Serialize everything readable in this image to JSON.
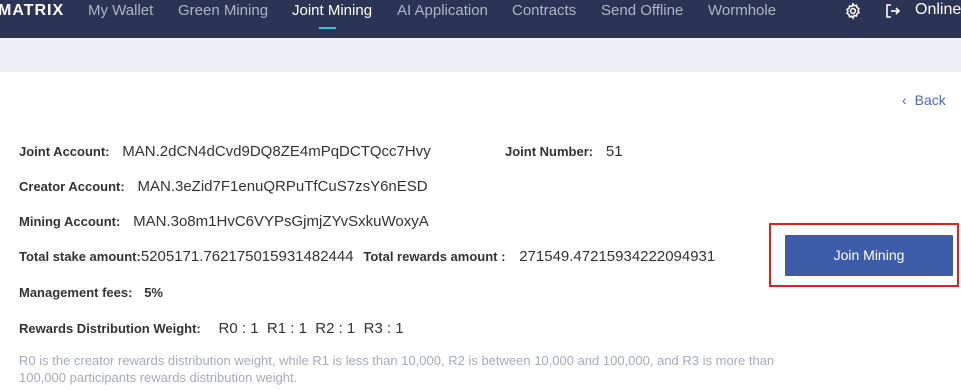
{
  "nav": {
    "brand": "MATRIX",
    "items": [
      {
        "label": "My Wallet"
      },
      {
        "label": "Green Mining"
      },
      {
        "label": "Joint Mining"
      },
      {
        "label": "AI Application"
      },
      {
        "label": "Contracts"
      },
      {
        "label": "Send Offline"
      },
      {
        "label": "Wormhole"
      }
    ],
    "active_item": "Joint Mining",
    "status": "Online",
    "settings_icon": "gear-icon",
    "logout_icon": "logout-icon"
  },
  "back": {
    "icon": "chevron-left-icon",
    "label": "Back"
  },
  "details": {
    "joint_account_label": "Joint Account:",
    "joint_account_value": "MAN.2dCN4dCvd9DQ8ZE4mPqDCTQcc7Hvy",
    "joint_number_label": "Joint Number:",
    "joint_number_value": "51",
    "creator_account_label": "Creator Account:",
    "creator_account_value": "MAN.3eZid7F1enuQRPuTfCuS7zsY6nESD",
    "mining_account_label": "Mining Account:",
    "mining_account_value": "MAN.3o8m1HvC6VYPsGjmjZYvSxkuWoxyA",
    "total_stake_label": "Total stake amount:",
    "total_stake_value": "5205171.762175015931482444",
    "total_rewards_label": "Total rewards amount :",
    "total_rewards_value": "271549.47215934222094931",
    "management_fees_label": "Management fees:",
    "management_fees_value": "5%",
    "rewards_weight_label": "Rewards Distribution Weight:",
    "rewards_weight_value": "R0 : 1  R1 : 1  R2 : 1  R3 : 1"
  },
  "note": "R0 is the creator rewards distribution weight, while R1 is less than 10,000, R2 is between 10,000 and 100,000, and R3 is more than 100,000 participants rewards distribution weight.",
  "join_button": {
    "label": "Join Mining"
  },
  "colors": {
    "navbar_bg": "#2b3454",
    "subheader_bg": "#eef0f6",
    "active_underline": "#2fc5d8",
    "button_bg": "#3e5da8",
    "highlight_border": "#e1201c",
    "link": "#4a6bb5"
  }
}
